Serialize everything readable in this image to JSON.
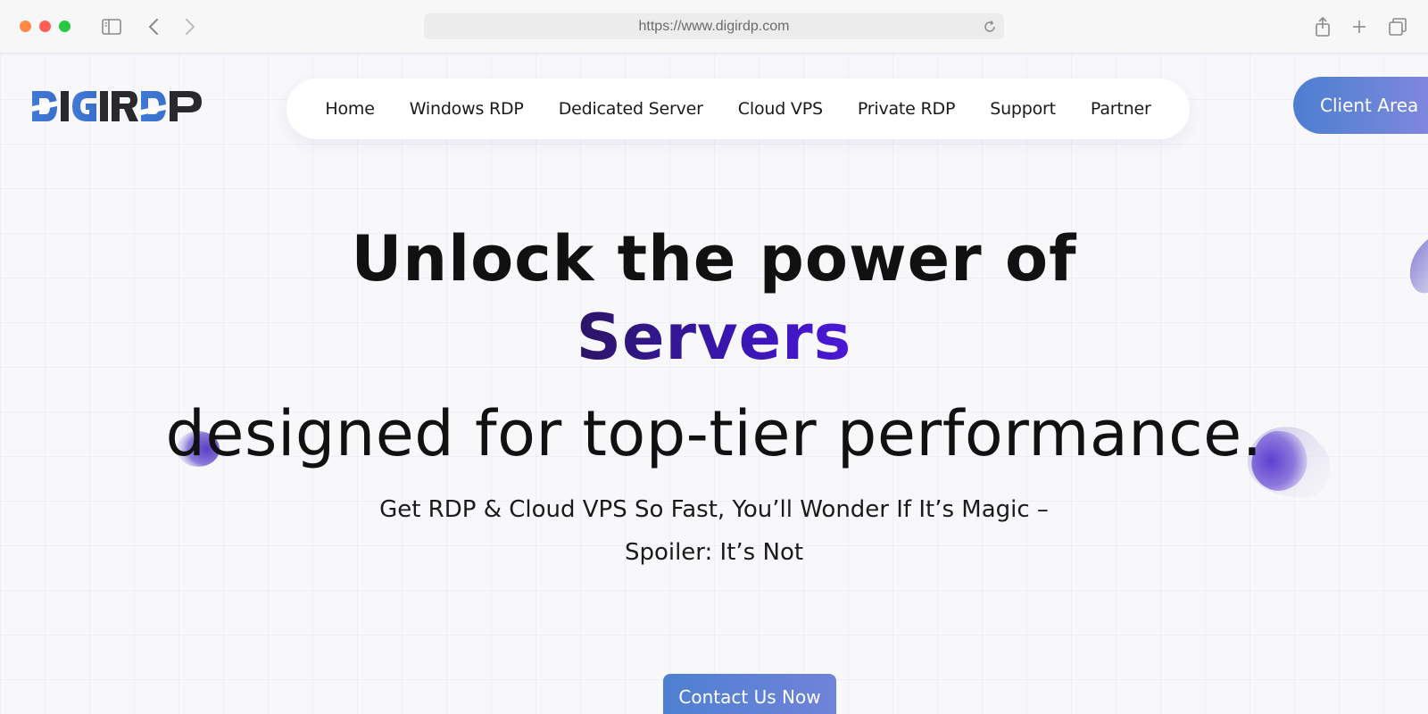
{
  "browser": {
    "url": "https://www.digirdp.com",
    "icons": [
      "sidebar-icon",
      "back-icon",
      "forward-icon",
      "reload-icon",
      "share-icon",
      "new-tab-icon",
      "tabs-icon"
    ]
  },
  "site": {
    "logo_text": "DIGIRDP",
    "nav": [
      {
        "label": "Home"
      },
      {
        "label": "Windows RDP"
      },
      {
        "label": "Dedicated Server"
      },
      {
        "label": "Cloud VPS"
      },
      {
        "label": "Private RDP"
      },
      {
        "label": "Support"
      },
      {
        "label": "Partner"
      }
    ],
    "client_area_label": "Client Area"
  },
  "hero": {
    "line1": "Unlock the power of",
    "accent": "Servers",
    "line3": "designed for top-tier performance.",
    "subtitle1": "Get RDP & Cloud VPS So Fast, You’ll Wonder If It’s Magic –",
    "subtitle2": "Spoiler: It’s Not",
    "cta_label": "Contact Us Now"
  },
  "colors": {
    "accent_dark": "#2b1565",
    "accent_purple": "#3a16b5",
    "button_blue": "#4e80d2",
    "button_violet": "#8a86e0"
  }
}
